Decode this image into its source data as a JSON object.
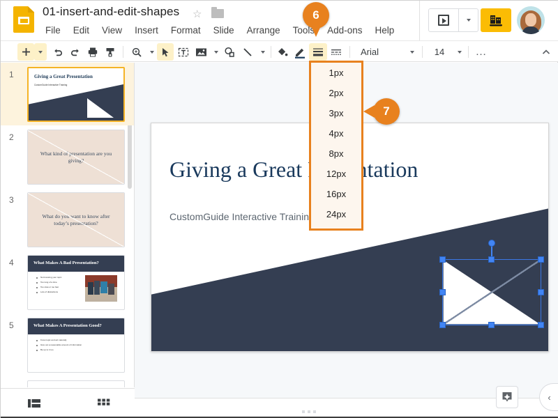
{
  "header": {
    "doc_title": "01-insert-and-edit-shapes",
    "star_icon": "star-outline-icon",
    "folder_icon": "move-to-folder-icon",
    "menus": [
      "File",
      "Edit",
      "View",
      "Insert",
      "Format",
      "Slide",
      "Arrange",
      "Tools",
      "Add-ons",
      "Help"
    ],
    "present_label": "present-icon",
    "present_dropdown": "chevron-down-icon",
    "business_icon": "business-profile-icon",
    "avatar": "user-avatar"
  },
  "toolbar": {
    "items": [
      {
        "name": "new-slide-button",
        "glyph": "+"
      },
      {
        "name": "new-slide-dropdown",
        "glyph": "caret"
      },
      {
        "name": "undo-button",
        "glyph": "undo"
      },
      {
        "name": "redo-button",
        "glyph": "redo"
      },
      {
        "name": "print-button",
        "glyph": "print"
      },
      {
        "name": "paint-format-button",
        "glyph": "paint"
      },
      {
        "name": "zoom-button",
        "glyph": "zoom"
      },
      {
        "name": "zoom-dropdown",
        "glyph": "caret"
      },
      {
        "name": "select-tool-button",
        "glyph": "cursor"
      },
      {
        "name": "text-box-button",
        "glyph": "textbox"
      },
      {
        "name": "insert-image-button",
        "glyph": "image"
      },
      {
        "name": "insert-image-dropdown",
        "glyph": "caret"
      },
      {
        "name": "shape-button",
        "glyph": "shape"
      },
      {
        "name": "line-button",
        "glyph": "line"
      },
      {
        "name": "line-dropdown",
        "glyph": "caret"
      },
      {
        "name": "fill-color-button",
        "glyph": "fill"
      },
      {
        "name": "border-color-button",
        "glyph": "pencil"
      },
      {
        "name": "border-weight-button",
        "glyph": "weight"
      },
      {
        "name": "border-dash-button",
        "glyph": "dash"
      }
    ],
    "font_name": "Arial",
    "font_name_dropdown": "chevron-down-icon",
    "font_size": "14",
    "font_size_dropdown": "chevron-down-icon",
    "more_options": "…",
    "collapse_toolbar": "chevron-up-icon",
    "accent_highlight": "#fdf1c8",
    "accent_underline": "#e8811e"
  },
  "border_weight_menu": {
    "options": [
      "1px",
      "2px",
      "3px",
      "4px",
      "8px",
      "12px",
      "16px",
      "24px"
    ],
    "border_color": "#e8811e",
    "background_color": "#fdf6ee"
  },
  "callouts": [
    {
      "number": "6",
      "target": "add-ons-menu"
    },
    {
      "number": "7",
      "target": "border-weight-3px-option"
    }
  ],
  "filmstrip": {
    "scrollbar": "vertical-scrollbar",
    "slides": [
      {
        "number": "1",
        "type": "title",
        "title": "Giving a Great Presentation",
        "subtitle": "CustomGuide Interactive Training",
        "selected": true
      },
      {
        "number": "2",
        "type": "question",
        "text": "What kind of presentation are you giving?",
        "selected": false
      },
      {
        "number": "3",
        "type": "question",
        "text": "What do you want to know after today’s presentation?",
        "selected": false
      },
      {
        "number": "4",
        "type": "content",
        "title": "What Makes A Bad Presentation?",
        "bullets": [
          "Not knowing your topic",
          "Too long of a time",
          "Too slow or too fast",
          "Lots of distractions"
        ],
        "has_photo": true,
        "selected": false
      },
      {
        "number": "5",
        "type": "content",
        "title": "What Makes A Presentation Good?",
        "bullets": [
          "Know topic and act naturally",
          "Give out a reasonable amount of information",
          "Be up to it too"
        ],
        "has_photo": false,
        "selected": false
      }
    ]
  },
  "view_bar": {
    "filmstrip_view": "filmstrip-view-icon",
    "grid_view": "grid-view-icon"
  },
  "slide": {
    "title": "Giving a Great Presentation",
    "subtitle": "CustomGuide Interactive Training",
    "band_color": "#343e52",
    "title_color": "#19395c",
    "shape": {
      "name": "right-triangle",
      "fill": "#ffffff",
      "selected": true,
      "handle_color": "#4285f4"
    }
  },
  "canvas_footer": {
    "notes_button": "explore-notes-icon",
    "collapse_panel": "chevron-left-icon",
    "drag_handle": "resize-drag-dots"
  }
}
